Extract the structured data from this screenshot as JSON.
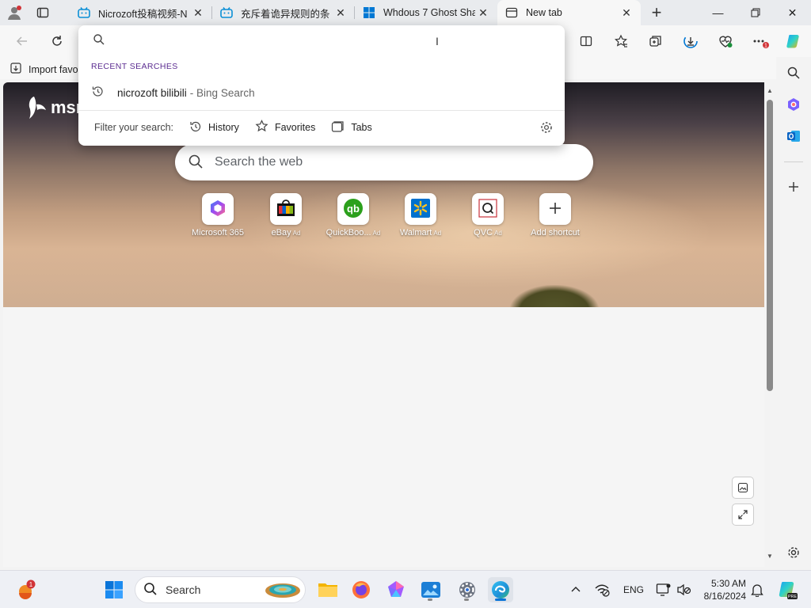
{
  "tabs": [
    {
      "title": "Nicrozoft投稿视频-N",
      "icon": "bilibili-icon",
      "active": false
    },
    {
      "title": "充斥着诡异规则的条",
      "icon": "bilibili-icon",
      "active": false
    },
    {
      "title": "Whdous 7 Ghost Sha",
      "icon": "windows-logo-icon",
      "active": false
    },
    {
      "title": "New tab",
      "icon": "newtab-page-icon",
      "active": true
    }
  ],
  "bookmarks_bar": {
    "import_label": "Import favo"
  },
  "address_dropdown": {
    "input_value": "",
    "recent_header": "RECENT SEARCHES",
    "recent_items": [
      {
        "query": "nicrozoft bilibili",
        "source": "- Bing Search"
      }
    ],
    "filter_label": "Filter your search:",
    "filters": [
      {
        "label": "History",
        "icon": "history-icon"
      },
      {
        "label": "Favorites",
        "icon": "star-icon"
      },
      {
        "label": "Tabs",
        "icon": "tabs-icon"
      }
    ]
  },
  "msn": {
    "logo_text": "msn"
  },
  "web_search": {
    "placeholder": "Search the web"
  },
  "shortcuts": [
    {
      "label": "Microsoft 365",
      "ad": "",
      "icon": "microsoft365-icon"
    },
    {
      "label": "eBay",
      "ad": "Ad",
      "icon": "ebay-bag-icon"
    },
    {
      "label": "QuickBoo...",
      "ad": "Ad",
      "icon": "quickbooks-icon"
    },
    {
      "label": "Walmart",
      "ad": "Ad",
      "icon": "walmart-icon"
    },
    {
      "label": "QVC",
      "ad": "Ad",
      "icon": "qvc-icon"
    },
    {
      "label": "Add shortcut",
      "ad": "",
      "icon": "plus-icon"
    }
  ],
  "taskbar": {
    "search_label": "Search",
    "notification_badge": "1",
    "language": "ENG",
    "time": "5:30 AM",
    "date": "8/16/2024"
  },
  "toolbar": {
    "downloads_badge": "1"
  },
  "colors": {
    "accent": "#0078d4",
    "recent_header": "#5c2d91",
    "tab_strip": "#e9ebee"
  }
}
